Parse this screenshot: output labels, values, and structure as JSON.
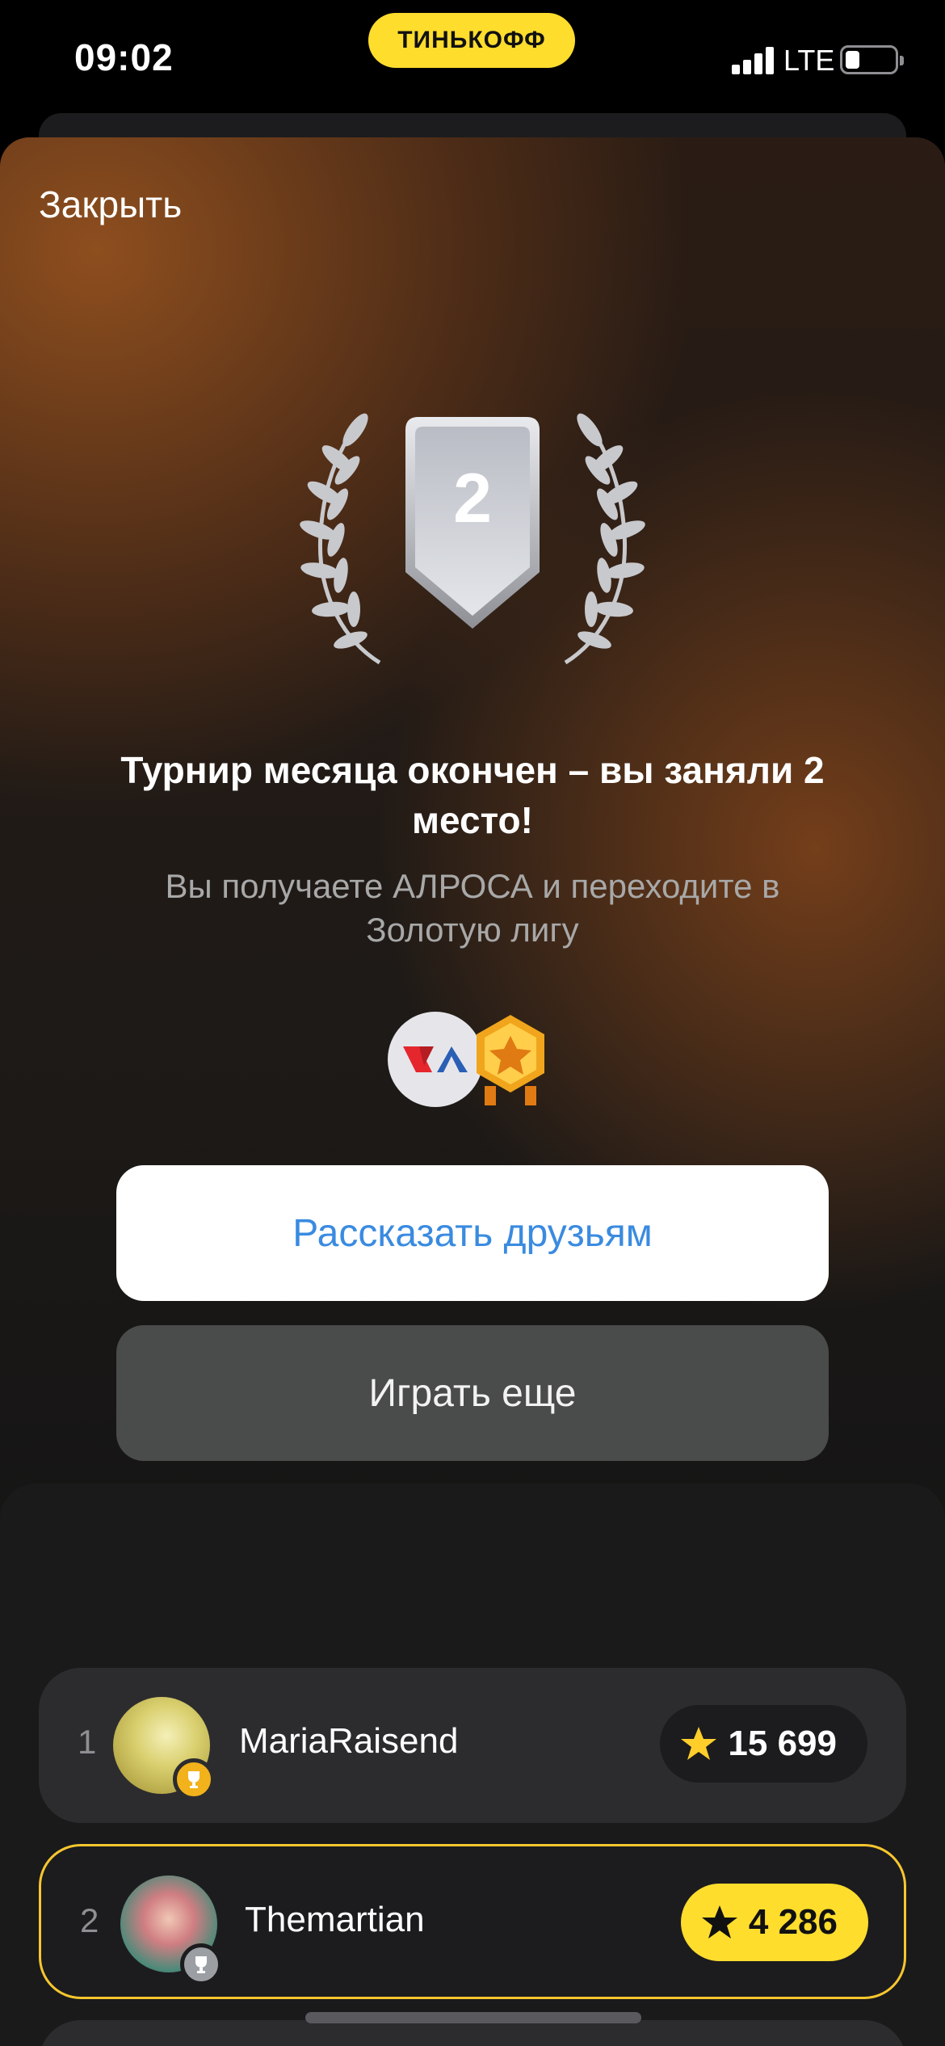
{
  "status_bar": {
    "time": "09:02",
    "brand": "ТИНЬКОФФ",
    "network": "LTE",
    "battery_level": 0.3
  },
  "modal": {
    "close_label": "Закрыть",
    "place": "2",
    "title": "Турнир месяца окончен – вы заняли 2 место!",
    "subtitle": "Вы получаете АЛРОСА и переходите в Золотую лигу",
    "rewards": [
      "alrosa-logo",
      "gold-league-badge"
    ],
    "share_button": "Рассказать друзьям",
    "play_button": "Играть еще"
  },
  "leaderboard": {
    "rows": [
      {
        "rank": "1",
        "name": "MariaRaisend",
        "score": "15 699",
        "badge": "gold-trophy-icon"
      },
      {
        "rank": "2",
        "name": "Themartian",
        "score": "4 286",
        "badge": "silver-trophy-icon",
        "highlighted": true
      }
    ]
  },
  "colors": {
    "accent_yellow": "#ffdd2d",
    "link_blue": "#3a8be0",
    "highlight_border": "#f7c62f"
  }
}
